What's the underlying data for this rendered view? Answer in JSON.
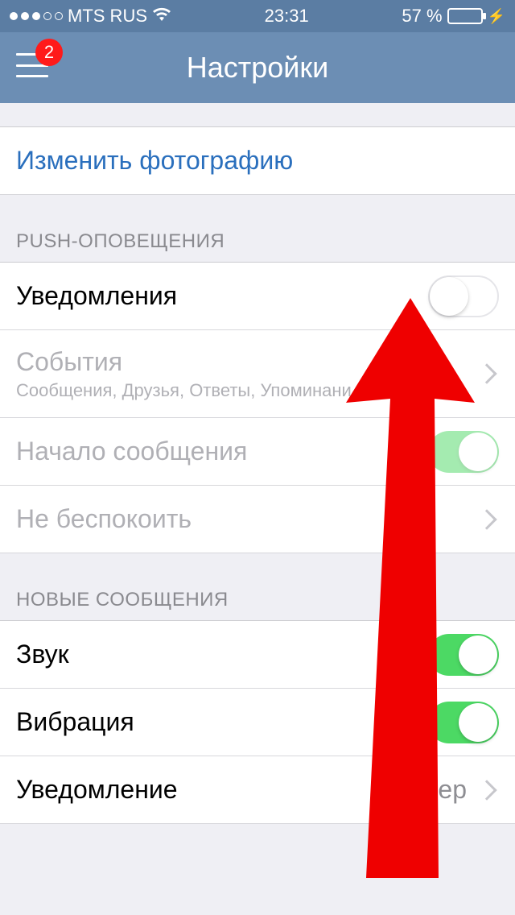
{
  "status_bar": {
    "carrier": "MTS RUS",
    "time": "23:31",
    "battery_pct": "57 %"
  },
  "nav": {
    "title": "Настройки",
    "badge": "2"
  },
  "top_link": "Изменить фотографию",
  "sections": {
    "push": {
      "header": "PUSH-ОПОВЕЩЕНИЯ",
      "notifications_label": "Уведомления",
      "events_label": "События",
      "events_sub": "Сообщения, Друзья, Ответы, Упоминани...",
      "msg_preview_label": "Начало сообщения",
      "dnd_label": "Не беспокоить"
    },
    "new_messages": {
      "header": "НОВЫЕ СООБЩЕНИЯ",
      "sound_label": "Звук",
      "vibration_label": "Вибрация",
      "notification_label": "Уведомление",
      "notification_value": "Баннер"
    }
  }
}
